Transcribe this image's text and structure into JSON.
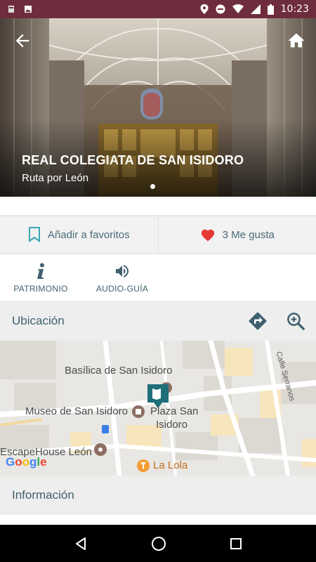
{
  "status_bar": {
    "time": "10:23"
  },
  "hero": {
    "title": "REAL COLEGIATA DE SAN ISIDORO",
    "subtitle": "Ruta por León"
  },
  "actions": {
    "favorites_label": "Añadir a favoritos",
    "likes_label": "3 Me gusta"
  },
  "tabs": [
    {
      "label": "PATRIMONIO",
      "icon": "info-icon"
    },
    {
      "label": "AUDIO-GUÍA",
      "icon": "speaker-icon"
    }
  ],
  "location": {
    "title": "Ubicación"
  },
  "map": {
    "labels": {
      "basilica": "Basílica de San Isidoro",
      "museo": "Museo de San Isidoro",
      "plaza_line1": "Plaza San",
      "plaza_line2": "Isidoro",
      "escape": "EscapeHouse León",
      "lola": "La Lola",
      "street": "Calle Serranos"
    },
    "logo": "Google"
  },
  "info": {
    "title": "Información"
  },
  "colors": {
    "status_bar": "#6e2d3c",
    "accent_teal": "#1f6f7a",
    "text_slate": "#3f5f6e",
    "heart_red": "#e53935"
  }
}
